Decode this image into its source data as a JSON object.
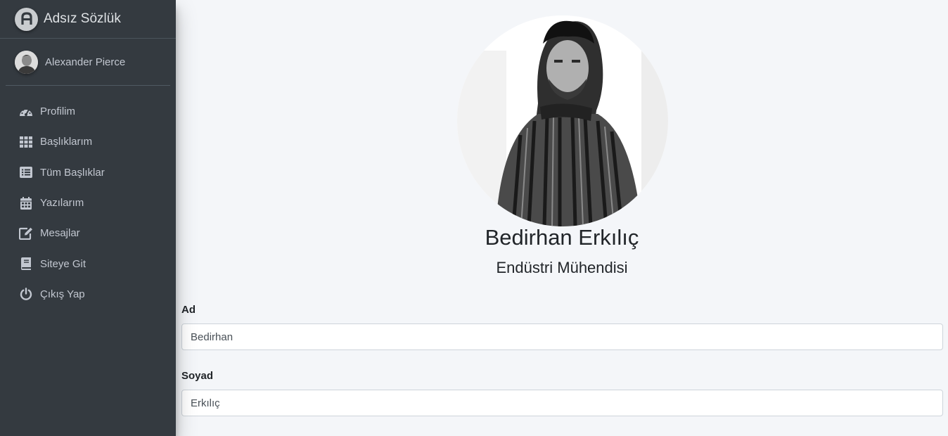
{
  "brand": {
    "name": "Adsız Sözlük",
    "logo_letter": "A"
  },
  "user": {
    "name": "Alexander Pierce"
  },
  "nav": [
    {
      "label": "Profilim",
      "icon": "tachometer-icon"
    },
    {
      "label": "Başlıklarım",
      "icon": "grid-icon"
    },
    {
      "label": "Tüm Başlıklar",
      "icon": "list-icon"
    },
    {
      "label": "Yazılarım",
      "icon": "calendar-icon"
    },
    {
      "label": "Mesajlar",
      "icon": "edit-icon"
    },
    {
      "label": "Siteye Git",
      "icon": "book-icon"
    },
    {
      "label": "Çıkış Yap",
      "icon": "power-icon"
    }
  ],
  "profile": {
    "full_name": "Bedirhan Erkılıç",
    "title": "Endüstri Mühendisi"
  },
  "form": {
    "first_name_label": "Ad",
    "first_name_value": "Bedirhan",
    "last_name_label": "Soyad",
    "last_name_value": "Erkılıç"
  },
  "colors": {
    "sidebar_bg": "#343a40",
    "sidebar_text": "#c2c7d0",
    "content_bg": "#f4f6f9"
  }
}
